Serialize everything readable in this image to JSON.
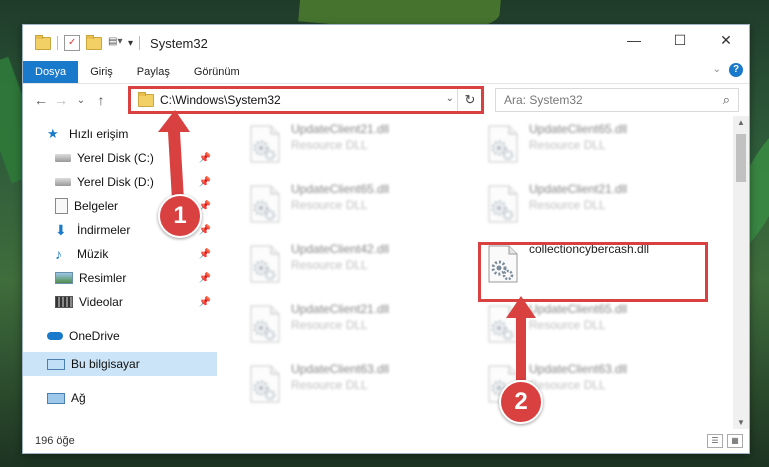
{
  "window": {
    "title": "System32",
    "controls": {
      "minimize": "—",
      "maximize": "☐",
      "close": "✕"
    }
  },
  "ribbon": {
    "tabs": [
      {
        "label": "Dosya",
        "active": true
      },
      {
        "label": "Giriş"
      },
      {
        "label": "Paylaş"
      },
      {
        "label": "Görünüm"
      }
    ],
    "help": "?"
  },
  "nav": {
    "back": "←",
    "forward": "→",
    "recent": "⌄",
    "up": "↑"
  },
  "address": {
    "path": "C:\\Windows\\System32",
    "refresh": "↻"
  },
  "search": {
    "placeholder": "Ara: System32"
  },
  "sidebar": {
    "quick_access": "Hızlı erişim",
    "items": [
      {
        "label": "Yerel Disk (C:)",
        "icon": "drive-icon"
      },
      {
        "label": "Yerel Disk (D:)",
        "icon": "drive-icon"
      },
      {
        "label": "Belgeler",
        "icon": "documents-icon"
      },
      {
        "label": "İndirmeler",
        "icon": "downloads-icon"
      },
      {
        "label": "Müzik",
        "icon": "music-icon"
      },
      {
        "label": "Resimler",
        "icon": "pictures-icon"
      },
      {
        "label": "Videolar",
        "icon": "videos-icon"
      }
    ],
    "onedrive": "OneDrive",
    "this_pc": "Bu bilgisayar",
    "network": "Ağ"
  },
  "files": [
    {
      "name": "UpdateClient21.dll",
      "desc": "Resource DLL"
    },
    {
      "name": "UpdateClient65.dll",
      "desc": "Resource DLL"
    },
    {
      "name": "UpdateClient65.dll",
      "desc": "Resource DLL"
    },
    {
      "name": "UpdateClient21.dll",
      "desc": "Resource DLL"
    },
    {
      "name": "UpdateClient42.dll",
      "desc": "Resource DLL"
    },
    {
      "name": "collectioncybercash.dll",
      "desc": ""
    },
    {
      "name": "UpdateClient21.dll",
      "desc": "Resource DLL"
    },
    {
      "name": "UpdateClient65.dll",
      "desc": "Resource DLL"
    },
    {
      "name": "UpdateClient63.dll",
      "desc": "Resource DLL"
    },
    {
      "name": "UpdateClient63.dll",
      "desc": "Resource DLL"
    }
  ],
  "status": {
    "count": "196 öğe"
  },
  "annotations": {
    "step1": "1",
    "step2": "2"
  },
  "colors": {
    "accent": "#1979ca",
    "annotation": "#d94040"
  }
}
